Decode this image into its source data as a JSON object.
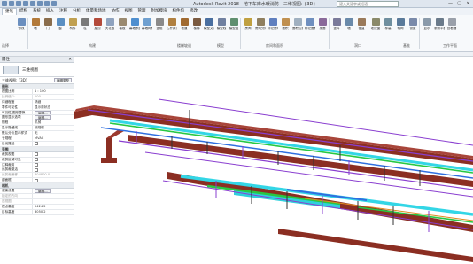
{
  "window": {
    "title": "Autodesk Revit 2018 -  地下车库水暖消防 - 三维视图: {3D}",
    "search_placeholder": "键入关键字或短语",
    "controls": [
      "—",
      "▢",
      "✕"
    ]
  },
  "tabs": [
    "建筑",
    "结构",
    "系统",
    "插入",
    "注释",
    "分析",
    "体量和场地",
    "协作",
    "视图",
    "管理",
    "附加模块",
    "构件坞",
    "修改"
  ],
  "active_tab": "建筑",
  "ribbon": {
    "buttons": [
      "修改",
      "墙",
      "门",
      "窗",
      "构件",
      "柱",
      "屋顶",
      "天花板",
      "楼板",
      "幕墙系统",
      "幕墙网格",
      "竖梃",
      "栏杆扶手",
      "坡道",
      "楼梯",
      "模型文字",
      "模型线",
      "模型组",
      "房间",
      "房间分隔",
      "标记房间",
      "面积",
      "面积边界",
      "标记面积",
      "按面",
      "竖井",
      "墙",
      "垂直",
      "老虎窗",
      "标高",
      "轴网",
      "设置",
      "显示",
      "参照平面",
      "查看器"
    ],
    "panels": [
      "选择",
      "构建",
      "楼梯坡道",
      "模型",
      "房间和面积",
      "洞口",
      "基准",
      "工作平面"
    ]
  },
  "properties": {
    "title": "属性",
    "type_name": "三维视图",
    "view_selector": "三维视图: {3D}",
    "edit_type_label": "编辑类型",
    "sections": {
      "graphics": "图形",
      "extents": "范围",
      "camera": "相机"
    },
    "graphics_rows": [
      {
        "k": "视图比例",
        "v": "1 : 100"
      },
      {
        "k": "比例值 1:",
        "v": "100"
      },
      {
        "k": "详细程度",
        "v": "精细"
      },
      {
        "k": "零件可见性",
        "v": "显示原状态"
      },
      {
        "k": "可见性/图形替换",
        "v": "编辑..."
      },
      {
        "k": "图形显示选项",
        "v": "编辑..."
      },
      {
        "k": "规程",
        "v": "机械"
      },
      {
        "k": "显示隐藏线",
        "v": "按规程"
      },
      {
        "k": "默认分析显示样式",
        "v": "无"
      },
      {
        "k": "子规程",
        "v": "MVAC"
      },
      {
        "k": "日光路径",
        "v": ""
      }
    ],
    "extents_rows": [
      {
        "k": "裁剪视图",
        "v": ""
      },
      {
        "k": "裁剪区域可见",
        "v": ""
      },
      {
        "k": "注释裁剪",
        "v": ""
      },
      {
        "k": "远剪裁激活",
        "v": ""
      },
      {
        "k": "远剪裁偏移",
        "v": "304800.0"
      },
      {
        "k": "剖面框",
        "v": ""
      }
    ],
    "camera_rows": [
      {
        "k": "渲染设置",
        "v": "编辑..."
      },
      {
        "k": "锁定的方向",
        "v": ""
      },
      {
        "k": "透视图",
        "v": ""
      },
      {
        "k": "视点高度",
        "v": "5424.2"
      },
      {
        "k": "目标高度",
        "v": "3050.2"
      }
    ]
  },
  "colors": {
    "duct": "#8b2e22",
    "pipe_purple": "#8a3fd0",
    "pipe_cyan": "#33d6e6",
    "pipe_green": "#28c843",
    "pipe_blue": "#2f6fe0",
    "pipe_orange": "#e08a20"
  }
}
